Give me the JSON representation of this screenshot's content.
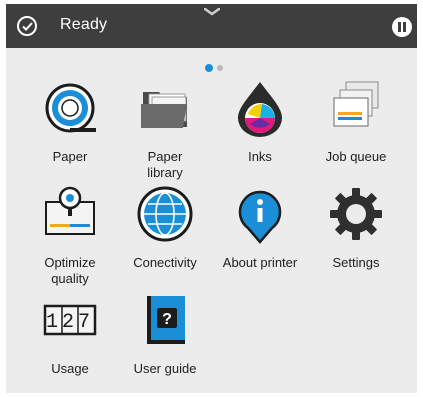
{
  "status": {
    "text": "Ready",
    "icon": "check-circle-icon"
  },
  "pager": {
    "active_page": 1,
    "pages": 2
  },
  "apps": [
    {
      "label": "Paper",
      "icon": "paper-roll-icon"
    },
    {
      "label": "Paper\nlibrary",
      "icon": "folder-icon"
    },
    {
      "label": "Inks",
      "icon": "ink-drop-icon"
    },
    {
      "label": "Job queue",
      "icon": "job-queue-icon"
    },
    {
      "label": "Optimize\nquality",
      "icon": "optimize-quality-icon"
    },
    {
      "label": "Conectivity",
      "icon": "globe-icon"
    },
    {
      "label": "About printer",
      "icon": "info-pin-icon"
    },
    {
      "label": "Settings",
      "icon": "gear-icon"
    },
    {
      "label": "Usage",
      "icon": "usage-counter-icon"
    },
    {
      "label": "User guide",
      "icon": "user-guide-icon"
    }
  ],
  "usage_counter_digits": "127",
  "user_guide_glyph": "?",
  "info_glyph": "i",
  "colors": {
    "statusbar": "#3e3e3e",
    "background": "#ececec",
    "accent": "#1a8fd8"
  }
}
